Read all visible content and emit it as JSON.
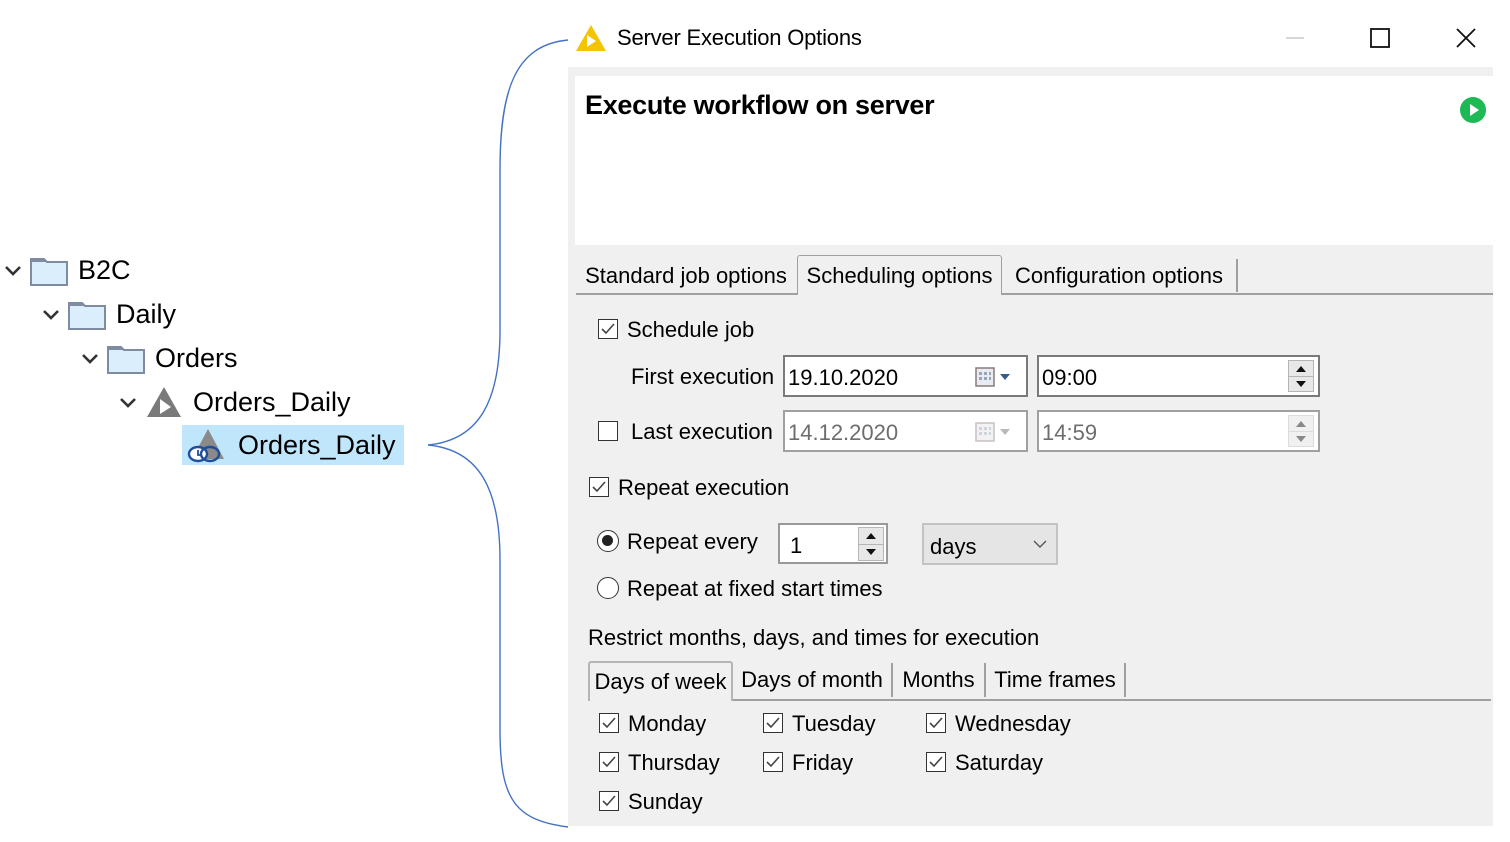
{
  "tree": {
    "items": [
      {
        "label": "B2C",
        "type": "folder",
        "level": 0,
        "expanded": true,
        "selected": false
      },
      {
        "label": "Daily",
        "type": "folder",
        "level": 1,
        "expanded": true,
        "selected": false
      },
      {
        "label": "Orders",
        "type": "folder",
        "level": 2,
        "expanded": true,
        "selected": false
      },
      {
        "label": "Orders_Daily",
        "type": "workflow",
        "level": 3,
        "expanded": true,
        "selected": false
      },
      {
        "label": "Orders_Daily",
        "type": "scheduled-job",
        "level": 4,
        "expanded": false,
        "selected": true
      }
    ]
  },
  "window": {
    "title": "Server Execution Options",
    "icon": "warning-triangle-icon",
    "controls": {
      "minimize": "minimize-icon",
      "maximize": "maximize-icon",
      "close": "close-icon"
    }
  },
  "header": {
    "title": "Execute workflow on server",
    "run_icon": "play-circle-icon"
  },
  "tabs": [
    {
      "label": "Standard job options",
      "active": false
    },
    {
      "label": "Scheduling options",
      "active": true
    },
    {
      "label": "Configuration options",
      "active": false
    }
  ],
  "scheduling": {
    "schedule_job": {
      "label": "Schedule job",
      "checked": true
    },
    "first_execution": {
      "label": "First execution",
      "date": "19.10.2020",
      "time": "09:00",
      "enabled": true
    },
    "last_execution": {
      "label": "Last execution",
      "checked": false,
      "date": "14.12.2020",
      "time": "14:59",
      "enabled": false
    },
    "repeat_execution": {
      "label": "Repeat execution",
      "checked": true
    },
    "repeat_every": {
      "label": "Repeat every",
      "selected": true,
      "value": "1",
      "unit": "days"
    },
    "repeat_fixed": {
      "label": "Repeat at fixed start times",
      "selected": false
    },
    "restrict_label": "Restrict months, days, and times for execution",
    "subtabs": [
      {
        "label": "Days of week",
        "active": true
      },
      {
        "label": "Days of month",
        "active": false
      },
      {
        "label": "Months",
        "active": false
      },
      {
        "label": "Time frames",
        "active": false
      }
    ],
    "days": [
      {
        "label": "Monday",
        "checked": true
      },
      {
        "label": "Tuesday",
        "checked": true
      },
      {
        "label": "Wednesday",
        "checked": true
      },
      {
        "label": "Thursday",
        "checked": true
      },
      {
        "label": "Friday",
        "checked": true
      },
      {
        "label": "Saturday",
        "checked": true
      },
      {
        "label": "Sunday",
        "checked": true
      }
    ]
  },
  "colors": {
    "selection": "#bfe6fb",
    "bracket": "#4472c4",
    "dialog_bg": "#f0f0f0",
    "run_green": "#1db954",
    "warning_yellow": "#f5c400"
  }
}
